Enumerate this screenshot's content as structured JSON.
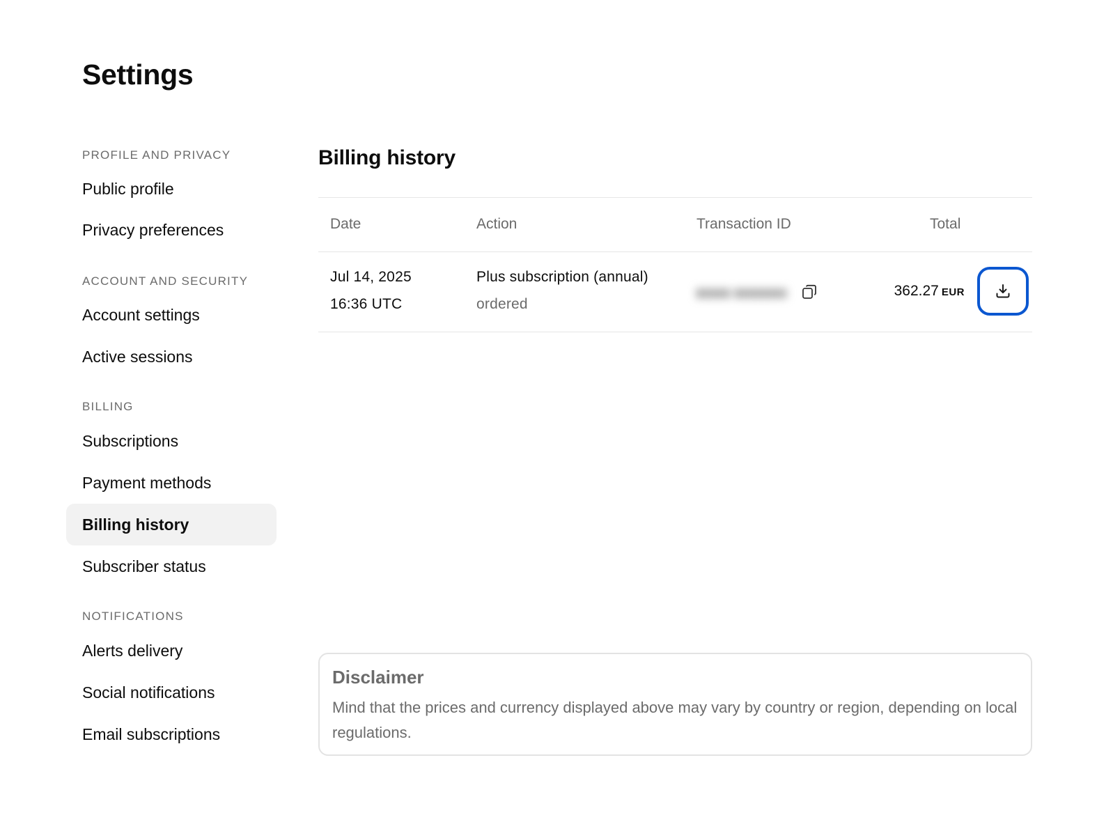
{
  "page": {
    "title": "Settings"
  },
  "sidebar": {
    "sections": [
      {
        "label": "PROFILE AND PRIVACY",
        "items": [
          "Public profile",
          "Privacy preferences"
        ]
      },
      {
        "label": "ACCOUNT AND SECURITY",
        "items": [
          "Account settings",
          "Active sessions"
        ]
      },
      {
        "label": "BILLING",
        "items": [
          "Subscriptions",
          "Payment methods",
          "Billing history",
          "Subscriber status"
        ]
      },
      {
        "label": "NOTIFICATIONS",
        "items": [
          "Alerts delivery",
          "Social notifications",
          "Email subscriptions"
        ]
      }
    ],
    "active_item": "Billing history"
  },
  "billing": {
    "title": "Billing history",
    "columns": {
      "date": "Date",
      "action": "Action",
      "transaction_id": "Transaction ID",
      "total": "Total"
    },
    "rows": [
      {
        "date": "Jul 14, 2025",
        "time": "16:36 UTC",
        "action": "Plus subscription (annual)",
        "status": "ordered",
        "amount": "362.27",
        "currency": "EUR"
      }
    ]
  },
  "disclaimer": {
    "title": "Disclaimer",
    "text": "Mind that the prices and currency displayed above may vary by country or region, depending on local regulations."
  },
  "icons": {
    "copy": "copy-icon",
    "download": "download-icon"
  },
  "colors": {
    "accent": "#0b57d0",
    "active_bg": "#f2f2f2",
    "muted_text": "#6b6b6b"
  }
}
